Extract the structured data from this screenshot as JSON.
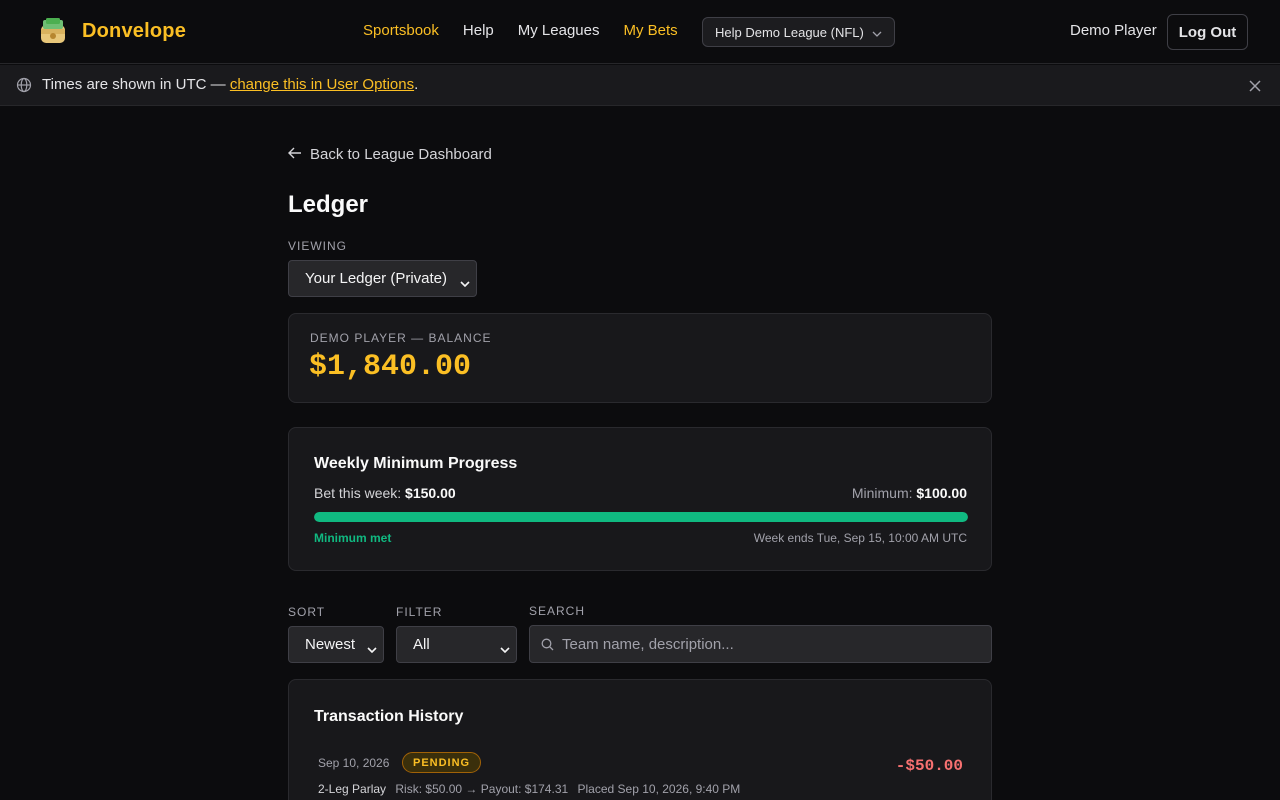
{
  "brand": {
    "name": "Donvelope"
  },
  "nav": {
    "links": [
      {
        "label": "Sportsbook"
      },
      {
        "label": "Help"
      },
      {
        "label": "My Leagues"
      },
      {
        "label": "My Bets"
      }
    ],
    "league_select": "Help Demo League (NFL)",
    "user": "Demo Player",
    "logout": "Log Out"
  },
  "notice": {
    "text": "Times are shown in UTC — ",
    "link": "change this in User Options",
    "end": "."
  },
  "page": {
    "back": "Back to League Dashboard",
    "title": "Ledger",
    "viewing_label": "VIEWING",
    "viewing_value": "Your Ledger (Private)"
  },
  "balance": {
    "label": "DEMO PLAYER — BALANCE",
    "amount": "$1,840.00"
  },
  "progress": {
    "title": "Weekly Minimum Progress",
    "bet_label": "Bet this week:",
    "bet_value": "$150.00",
    "min_label": "Minimum:",
    "min_value": "$100.00",
    "fraction": 1.0,
    "status": "Minimum met",
    "week_ends": "Week ends Tue, Sep 15, 10:00 AM UTC"
  },
  "controls": {
    "sort_label": "SORT",
    "sort_value": "Newest",
    "filter_label": "FILTER",
    "filter_value": "All",
    "search_label": "SEARCH",
    "search_placeholder": "Team name, description..."
  },
  "transactions": {
    "title": "Transaction History",
    "items": [
      {
        "date": "Sep 10, 2026",
        "badge": "PENDING",
        "amount": "-$50.00",
        "type": "2-Leg Parlay",
        "details": "Risk: $50.00 → Payout: $174.31",
        "placed": "Placed Sep 10, 2026, 9:40 PM"
      }
    ]
  },
  "colors": {
    "accent": "#fbbf24",
    "success": "#10b981",
    "negative": "#f87171",
    "background": "#0c0c0e"
  },
  "icons": [
    "money-bag-icon",
    "chevron-down-icon",
    "globe-icon",
    "close-icon",
    "arrow-left-icon",
    "search-icon"
  ]
}
